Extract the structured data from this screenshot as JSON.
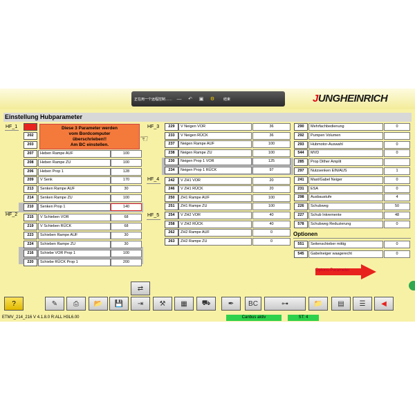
{
  "remote_bar": {
    "text": "正在用一个远程控制……",
    "close_label": "结束"
  },
  "logo": {
    "j": "J",
    "rest": "UNGHEINRICH"
  },
  "title": "Einstellung Hubparameter",
  "warning": {
    "lines": [
      "Diese 3 Parameter werden",
      "vom Bordcomputer",
      "überschrieben!!",
      "Am BC einstellen."
    ]
  },
  "groups": {
    "hf1": "HF_1",
    "hf2": "HF_2",
    "hf3": "HF_3",
    "hf4": "HF_4",
    "hf5": "HF_5"
  },
  "col1": [
    {
      "n": "201",
      "label": "",
      "value": ""
    },
    {
      "n": "202",
      "label": "",
      "value": ""
    },
    {
      "n": "203",
      "label": "",
      "value": ""
    },
    {
      "n": "207",
      "label": "Heben  Rampe AUF",
      "value": "100"
    },
    {
      "n": "208",
      "label": "Heben  Rampe ZU",
      "value": "100"
    },
    {
      "n": "206",
      "label": "Heben Prop  1",
      "value": "128"
    },
    {
      "n": "209",
      "label": "V  Senk",
      "value": "170"
    },
    {
      "n": "213",
      "label": "Senken  Rampe AUF",
      "value": "30"
    },
    {
      "n": "214",
      "label": "Senken  Rampe ZU",
      "value": "100"
    },
    {
      "n": "210",
      "label": "Senken Prop  1",
      "value": "140"
    },
    {
      "n": "215",
      "label": "V  Schieben VOR",
      "value": "68"
    },
    {
      "n": "219",
      "label": "V  Schieben RÜCK",
      "value": "68"
    },
    {
      "n": "223",
      "label": "Schieben  Rampe AUF",
      "value": "30"
    },
    {
      "n": "224",
      "label": "Schieben  Rampe ZU",
      "value": "30"
    },
    {
      "n": "216",
      "label": "Schiebe VOR Prop  1",
      "value": "100"
    },
    {
      "n": "220",
      "label": "Schiebe RÜCK Prop  1",
      "value": "200"
    }
  ],
  "col2": [
    {
      "n": "229",
      "label": "V  Neigen VOR",
      "value": "36"
    },
    {
      "n": "233",
      "label": "V  Neigen RÜCK",
      "value": "36"
    },
    {
      "n": "237",
      "label": "Neigen  Rampe AUF",
      "value": "100"
    },
    {
      "n": "238",
      "label": "Neigen  Rampe ZU",
      "value": "100"
    },
    {
      "n": "230",
      "label": "Neigen  Prop  1 VOR",
      "value": "125"
    },
    {
      "n": "234",
      "label": "Neigen  Prop  1 RÜCK",
      "value": "97"
    },
    {
      "n": "242",
      "label": "V   ZH1 VOR",
      "value": "20"
    },
    {
      "n": "246",
      "label": "V  ZH1 RÜCK",
      "value": "20"
    },
    {
      "n": "250",
      "label": "ZH1  Rampe AUF",
      "value": "100"
    },
    {
      "n": "251",
      "label": "ZH1  Rampe ZU",
      "value": "100"
    },
    {
      "n": "254",
      "label": "V  ZH2 VOR",
      "value": "40"
    },
    {
      "n": "258",
      "label": "V  ZH2 RÜCK",
      "value": "40"
    },
    {
      "n": "262",
      "label": "ZH2  Rampe AUF",
      "value": "0"
    },
    {
      "n": "263",
      "label": "ZH2  Rampe ZU",
      "value": "0"
    }
  ],
  "col3": [
    {
      "n": "290",
      "label": "Mehrfachbedienung",
      "value": "0"
    },
    {
      "n": "292",
      "label": "Pumpen  Volumen",
      "value": ""
    },
    {
      "n": "293",
      "label": "Hubmotor-Auswahl",
      "value": "0"
    },
    {
      "n": "544",
      "label": "MVD",
      "value": "0"
    },
    {
      "n": "285",
      "label": "Prop  Dither  Amplit",
      "value": ""
    },
    {
      "n": "297",
      "label": "Nutzsenken EIN/AUS",
      "value": "1"
    },
    {
      "n": "241",
      "label": "Mast/Gabel  Neiger",
      "value": "0"
    },
    {
      "n": "231",
      "label": "ESA",
      "value": "0"
    },
    {
      "n": "298",
      "label": "Ausbaustufe",
      "value": "4"
    },
    {
      "n": "226",
      "label": "Schubweg",
      "value": "50"
    },
    {
      "n": "227",
      "label": "Schub  Inkremente",
      "value": "48"
    },
    {
      "n": "578",
      "label": "Schubweg  Reduzierung",
      "value": "0"
    }
  ],
  "options": {
    "title": "Optionen",
    "rows": [
      {
        "n": "551",
        "label": "Seitenschieber mittig",
        "value": "0"
      },
      {
        "n": "545",
        "label": "Gabelneiger waagerecht",
        "value": "0"
      }
    ],
    "params_link": "Optons-Parameter"
  },
  "toolbar": [
    {
      "name": "help-button",
      "glyph": "?"
    },
    {
      "name": "edit-button",
      "glyph": "✎"
    },
    {
      "name": "print-button",
      "glyph": "⎙"
    },
    {
      "name": "open-folder-button",
      "glyph": "📂"
    },
    {
      "name": "save-button",
      "glyph": "💾"
    },
    {
      "name": "import-button",
      "glyph": "⇥"
    },
    {
      "name": "tools-button",
      "glyph": "⚒"
    },
    {
      "name": "monitor-button",
      "glyph": "▦"
    },
    {
      "name": "truck-button",
      "glyph": "⛟"
    },
    {
      "name": "calibrate-button",
      "glyph": "✒"
    },
    {
      "name": "bc-button",
      "glyph": "BC"
    },
    {
      "name": "diagram-button",
      "glyph": "⊶"
    },
    {
      "name": "folder-export-button",
      "glyph": "📁"
    },
    {
      "name": "chart-button",
      "glyph": "▤"
    },
    {
      "name": "list-button",
      "glyph": "☰"
    },
    {
      "name": "back-button",
      "glyph": "◀"
    }
  ],
  "status": {
    "version": "ETMV_214_216 V 4.1.8.0 R:ALL H3L6.00",
    "canbus": "Canbus aktiv",
    "st": "ST: 4"
  }
}
